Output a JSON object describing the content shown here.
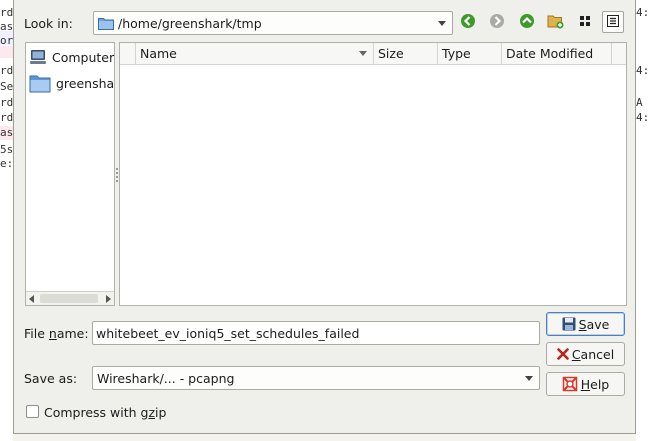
{
  "background_window": {
    "left_fragments": [
      "rd",
      "as",
      "or",
      "rd",
      "Se",
      "rd",
      "rd",
      "as",
      "5s",
      "e:"
    ],
    "right_fragments": [
      "4:",
      "4:",
      "A",
      "4:"
    ]
  },
  "look_in": {
    "label": "Look in:",
    "path": "/home/greenshark/tmp"
  },
  "toolbar": {
    "icons": [
      "back-icon",
      "forward-icon",
      "up-icon",
      "new-folder-icon",
      "icon-view-icon",
      "detail-view-icon"
    ]
  },
  "places": [
    {
      "label": "Computer",
      "icon": "computer-icon"
    },
    {
      "label": "greenshark",
      "icon": "folder-icon"
    }
  ],
  "file_list": {
    "columns": [
      "Name",
      "Size",
      "Type",
      "Date Modified"
    ],
    "rows": []
  },
  "file_name": {
    "label_pre": "File ",
    "label_mnemonic": "n",
    "label_post": "ame:",
    "value": "whitebeet_ev_ioniq5_set_schedules_failed"
  },
  "save_as": {
    "label": "Save as:",
    "value": "Wireshark/... - pcapng"
  },
  "compress": {
    "label_pre": "Compress with g",
    "label_mnemonic": "z",
    "label_post": "ip",
    "checked": false
  },
  "buttons": {
    "save_mnemonic": "S",
    "save_rest": "ave",
    "cancel_mnemonic": "C",
    "cancel_rest": "ancel",
    "help_mnemonic": "H",
    "help_rest": "elp"
  },
  "colors": {
    "accent": "#4f7fb8",
    "nav_green": "#3f9a2c",
    "nav_disabled": "#a9a9a6"
  }
}
